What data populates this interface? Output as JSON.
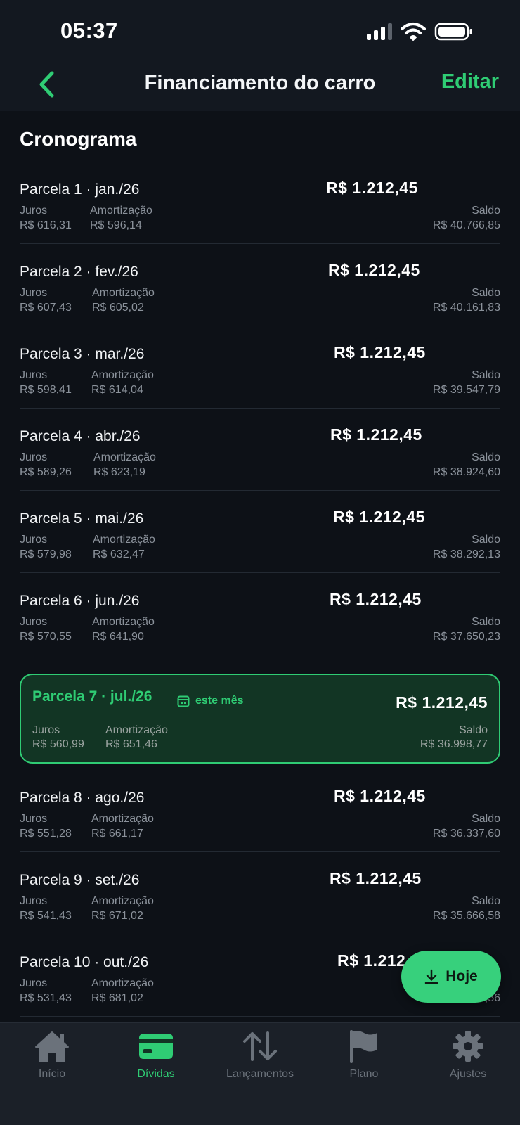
{
  "status_bar": {
    "time": "05:37"
  },
  "header": {
    "title": "Financiamento do carro",
    "edit_label": "Editar"
  },
  "section": {
    "title": "Cronograma"
  },
  "labels": {
    "juros": "Juros",
    "amortizacao": "Amortização",
    "saldo": "Saldo"
  },
  "installments": [
    {
      "title": "Parcela 1 · jan./26",
      "amount": "R$ 1.212,45",
      "juros": "R$ 616,31",
      "amortizacao": "R$ 596,14",
      "saldo": "R$ 40.766,85"
    },
    {
      "title": "Parcela 2 · fev./26",
      "amount": "R$ 1.212,45",
      "juros": "R$ 607,43",
      "amortizacao": "R$ 605,02",
      "saldo": "R$ 40.161,83"
    },
    {
      "title": "Parcela 3 · mar./26",
      "amount": "R$ 1.212,45",
      "juros": "R$ 598,41",
      "amortizacao": "R$ 614,04",
      "saldo": "R$ 39.547,79"
    },
    {
      "title": "Parcela 4 · abr./26",
      "amount": "R$ 1.212,45",
      "juros": "R$ 589,26",
      "amortizacao": "R$ 623,19",
      "saldo": "R$ 38.924,60"
    },
    {
      "title": "Parcela 5 · mai./26",
      "amount": "R$ 1.212,45",
      "juros": "R$ 579,98",
      "amortizacao": "R$ 632,47",
      "saldo": "R$ 38.292,13"
    },
    {
      "title": "Parcela 6 · jun./26",
      "amount": "R$ 1.212,45",
      "juros": "R$ 570,55",
      "amortizacao": "R$ 641,90",
      "saldo": "R$ 37.650,23"
    },
    {
      "title": "Parcela 7 · jul./26",
      "amount": "R$ 1.212,45",
      "juros": "R$ 560,99",
      "amortizacao": "R$ 651,46",
      "saldo": "R$ 36.998,77",
      "tag": "este mês"
    },
    {
      "title": "Parcela 8 · ago./26",
      "amount": "R$ 1.212,45",
      "juros": "R$ 551,28",
      "amortizacao": "R$ 661,17",
      "saldo": "R$ 36.337,60"
    },
    {
      "title": "Parcela 9 · set./26",
      "amount": "R$ 1.212,45",
      "juros": "R$ 541,43",
      "amortizacao": "R$ 671,02",
      "saldo": "R$ 35.666,58"
    },
    {
      "title": "Parcela 10 · out./26",
      "amount": "R$ 1.212,45",
      "juros": "R$ 531,43",
      "amortizacao": "R$ 681,02",
      "saldo": "R$ 34.985,56"
    }
  ],
  "fab": {
    "label": "Hoje",
    "icon": "download-arrow-icon"
  },
  "tabbar": {
    "items": [
      {
        "label": "Início",
        "icon": "home-icon"
      },
      {
        "label": "Dívidas",
        "icon": "card-icon",
        "active": true
      },
      {
        "label": "Lançamentos",
        "icon": "arrows-up-down-icon"
      },
      {
        "label": "Plano",
        "icon": "flag-icon"
      },
      {
        "label": "Ajustes",
        "icon": "gear-icon"
      }
    ]
  },
  "colors": {
    "accent": "#2fcc74",
    "background": "#0d1117",
    "current_bg": "#123524",
    "tabbar_bg": "#1b2028"
  }
}
